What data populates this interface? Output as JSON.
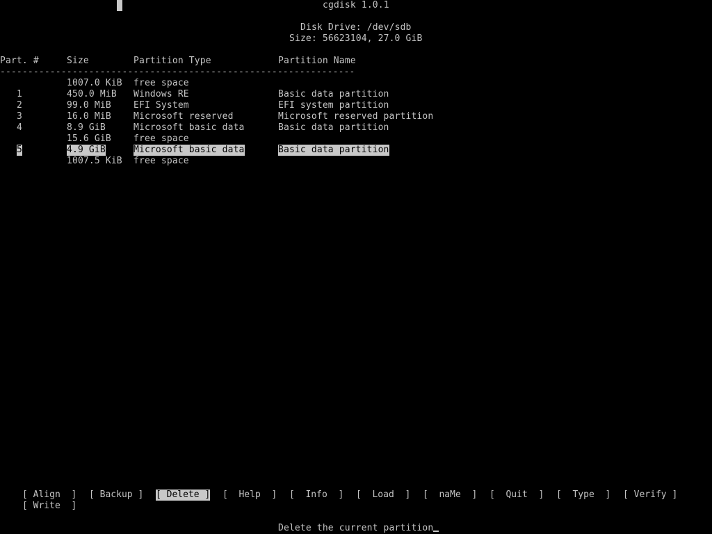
{
  "app": {
    "title": "cgdisk 1.0.1"
  },
  "disk": {
    "drive_label": "Disk Drive: /dev/sdb",
    "size_label": "Size: 56623104, 27.0 GiB"
  },
  "table": {
    "headers": [
      "Part. #",
      "Size",
      "Partition Type",
      "Partition Name"
    ],
    "separator": "----------------------------------------------------------------",
    "rows": [
      {
        "num": "",
        "size": "1007.0 KiB",
        "type": "free space",
        "name": ""
      },
      {
        "num": "1",
        "size": "450.0 MiB",
        "type": "Windows RE",
        "name": "Basic data partition"
      },
      {
        "num": "2",
        "size": "99.0 MiB",
        "type": "EFI System",
        "name": "EFI system partition"
      },
      {
        "num": "3",
        "size": "16.0 MiB",
        "type": "Microsoft reserved",
        "name": "Microsoft reserved partition"
      },
      {
        "num": "4",
        "size": "8.9 GiB",
        "type": "Microsoft basic data",
        "name": "Basic data partition"
      },
      {
        "num": "",
        "size": "15.6 GiB",
        "type": "free space",
        "name": ""
      },
      {
        "num": "5",
        "size": "4.9 GiB",
        "type": "Microsoft basic data",
        "name": "Basic data partition",
        "selected": true
      },
      {
        "num": "",
        "size": "1007.5 KiB",
        "type": "free space",
        "name": ""
      }
    ]
  },
  "menu": {
    "items": [
      {
        "label": "[ Align  ]"
      },
      {
        "label": "[ Backup ]"
      },
      {
        "label": "[ Delete ]",
        "selected": true
      },
      {
        "label": "[  Help  ]"
      },
      {
        "label": "[  Info  ]"
      },
      {
        "label": "[  Load  ]"
      },
      {
        "label": "[  naMe  ]"
      },
      {
        "label": "[  Quit  ]"
      },
      {
        "label": "[  Type  ]"
      },
      {
        "label": "[ Verify ]"
      },
      {
        "label": "[ Write  ]"
      }
    ]
  },
  "status": {
    "text": "Delete the current partition"
  },
  "colors": {
    "background": "#000000",
    "text": "#c4c4c4",
    "highlight": "#c8c8c8"
  }
}
